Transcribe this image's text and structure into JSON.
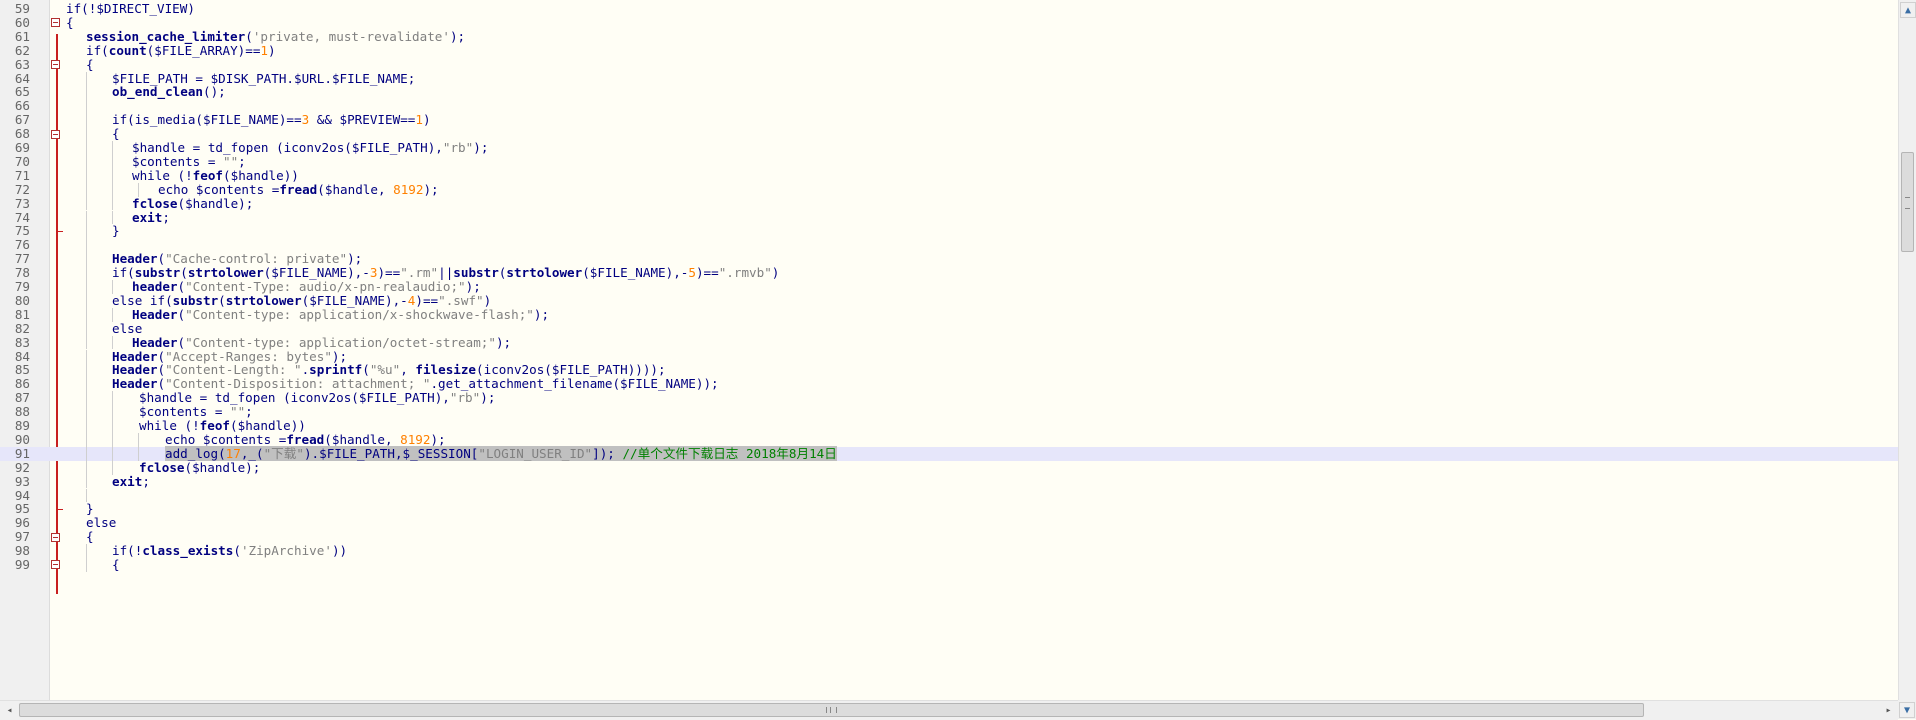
{
  "editor": {
    "lines": [
      {
        "n": "59",
        "indent": 0,
        "fold": "",
        "tokens": [
          [
            "kw",
            "if(!"
          ],
          [
            "var",
            "$DIRECT_VIEW"
          ],
          [
            "kw",
            ")"
          ]
        ]
      },
      {
        "n": "60",
        "indent": 0,
        "fold": "open",
        "tokens": [
          [
            "kw",
            "{"
          ]
        ]
      },
      {
        "n": "61",
        "indent": 1,
        "fold": "",
        "tokens": [
          [
            "fn",
            "session_cache_limiter"
          ],
          [
            "kw",
            "("
          ],
          [
            "str",
            "'private, must-revalidate'"
          ],
          [
            "kw",
            ");"
          ]
        ]
      },
      {
        "n": "62",
        "indent": 1,
        "fold": "",
        "tokens": [
          [
            "kw",
            "if("
          ],
          [
            "fn",
            "count"
          ],
          [
            "kw",
            "("
          ],
          [
            "var",
            "$FILE_ARRAY"
          ],
          [
            "kw",
            ")=="
          ],
          [
            "num",
            "1"
          ],
          [
            "kw",
            ")"
          ]
        ]
      },
      {
        "n": "63",
        "indent": 1,
        "fold": "open",
        "tokens": [
          [
            "kw",
            "{"
          ]
        ]
      },
      {
        "n": "64",
        "indent": 2,
        "fold": "",
        "tokens": [
          [
            "var",
            "$FILE_PATH"
          ],
          [
            "kw",
            " = "
          ],
          [
            "var",
            "$DISK_PATH"
          ],
          [
            "kw",
            "."
          ],
          [
            "var",
            "$URL"
          ],
          [
            "kw",
            "."
          ],
          [
            "var",
            "$FILE_NAME"
          ],
          [
            "kw",
            ";"
          ]
        ]
      },
      {
        "n": "65",
        "indent": 2,
        "fold": "",
        "tokens": [
          [
            "fn",
            "ob_end_clean"
          ],
          [
            "kw",
            "();"
          ]
        ]
      },
      {
        "n": "66",
        "indent": 2,
        "fold": "",
        "tokens": []
      },
      {
        "n": "67",
        "indent": 2,
        "fold": "",
        "tokens": [
          [
            "kw",
            "if(is_media("
          ],
          [
            "var",
            "$FILE_NAME"
          ],
          [
            "kw",
            ")=="
          ],
          [
            "num",
            "3"
          ],
          [
            "kw",
            " && "
          ],
          [
            "var",
            "$PREVIEW"
          ],
          [
            "kw",
            "=="
          ],
          [
            "num",
            "1"
          ],
          [
            "kw",
            ")"
          ]
        ]
      },
      {
        "n": "68",
        "indent": 2,
        "fold": "open",
        "tokens": [
          [
            "kw",
            "{"
          ]
        ]
      },
      {
        "n": "69",
        "indent": 3,
        "fold": "",
        "tokens": [
          [
            "var",
            "$handle"
          ],
          [
            "kw",
            " = td_fopen (iconv2os("
          ],
          [
            "var",
            "$FILE_PATH"
          ],
          [
            "kw",
            "),"
          ],
          [
            "str",
            "\"rb\""
          ],
          [
            "kw",
            ");"
          ]
        ]
      },
      {
        "n": "70",
        "indent": 3,
        "fold": "",
        "tokens": [
          [
            "var",
            "$contents"
          ],
          [
            "kw",
            " = "
          ],
          [
            "str",
            "\"\""
          ],
          [
            "kw",
            ";"
          ]
        ]
      },
      {
        "n": "71",
        "indent": 3,
        "fold": "",
        "tokens": [
          [
            "kw",
            "while (!"
          ],
          [
            "fn",
            "feof"
          ],
          [
            "kw",
            "("
          ],
          [
            "var",
            "$handle"
          ],
          [
            "kw",
            "))"
          ]
        ]
      },
      {
        "n": "72",
        "indent": 4,
        "fold": "",
        "tokens": [
          [
            "kw",
            "echo "
          ],
          [
            "var",
            "$contents"
          ],
          [
            "kw",
            " ="
          ],
          [
            "fn",
            "fread"
          ],
          [
            "kw",
            "("
          ],
          [
            "var",
            "$handle"
          ],
          [
            "kw",
            ", "
          ],
          [
            "num",
            "8192"
          ],
          [
            "kw",
            ");"
          ]
        ]
      },
      {
        "n": "73",
        "indent": 3,
        "fold": "",
        "tokens": [
          [
            "fn",
            "fclose"
          ],
          [
            "kw",
            "("
          ],
          [
            "var",
            "$handle"
          ],
          [
            "kw",
            ");"
          ]
        ]
      },
      {
        "n": "74",
        "indent": 3,
        "fold": "",
        "tokens": [
          [
            "fn",
            "exit"
          ],
          [
            "kw",
            ";"
          ]
        ]
      },
      {
        "n": "75",
        "indent": 2,
        "fold": "end",
        "tokens": [
          [
            "kw",
            "}"
          ]
        ]
      },
      {
        "n": "76",
        "indent": 2,
        "fold": "",
        "tokens": []
      },
      {
        "n": "77",
        "indent": 2,
        "fold": "",
        "tokens": [
          [
            "fn",
            "Header"
          ],
          [
            "kw",
            "("
          ],
          [
            "str",
            "\"Cache-control: private\""
          ],
          [
            "kw",
            ");"
          ]
        ]
      },
      {
        "n": "78",
        "indent": 2,
        "fold": "",
        "tokens": [
          [
            "kw",
            "if("
          ],
          [
            "fn",
            "substr"
          ],
          [
            "kw",
            "("
          ],
          [
            "fn",
            "strtolower"
          ],
          [
            "kw",
            "("
          ],
          [
            "var",
            "$FILE_NAME"
          ],
          [
            "kw",
            "),-"
          ],
          [
            "num",
            "3"
          ],
          [
            "kw",
            ")=="
          ],
          [
            "str",
            "\".rm\""
          ],
          [
            "kw",
            "||"
          ],
          [
            "fn",
            "substr"
          ],
          [
            "kw",
            "("
          ],
          [
            "fn",
            "strtolower"
          ],
          [
            "kw",
            "("
          ],
          [
            "var",
            "$FILE_NAME"
          ],
          [
            "kw",
            "),-"
          ],
          [
            "num",
            "5"
          ],
          [
            "kw",
            ")=="
          ],
          [
            "str",
            "\".rmvb\""
          ],
          [
            "kw",
            ")"
          ]
        ]
      },
      {
        "n": "79",
        "indent": 3,
        "fold": "",
        "tokens": [
          [
            "fn",
            "header"
          ],
          [
            "kw",
            "("
          ],
          [
            "str",
            "\"Content-Type: audio/x-pn-realaudio;\""
          ],
          [
            "kw",
            ");"
          ]
        ]
      },
      {
        "n": "80",
        "indent": 2,
        "fold": "",
        "tokens": [
          [
            "kw",
            "else if("
          ],
          [
            "fn",
            "substr"
          ],
          [
            "kw",
            "("
          ],
          [
            "fn",
            "strtolower"
          ],
          [
            "kw",
            "("
          ],
          [
            "var",
            "$FILE_NAME"
          ],
          [
            "kw",
            "),-"
          ],
          [
            "num",
            "4"
          ],
          [
            "kw",
            ")=="
          ],
          [
            "str",
            "\".swf\""
          ],
          [
            "kw",
            ")"
          ]
        ]
      },
      {
        "n": "81",
        "indent": 3,
        "fold": "",
        "tokens": [
          [
            "fn",
            "Header"
          ],
          [
            "kw",
            "("
          ],
          [
            "str",
            "\"Content-type: application/x-shockwave-flash;\""
          ],
          [
            "kw",
            ");"
          ]
        ]
      },
      {
        "n": "82",
        "indent": 2,
        "fold": "",
        "tokens": [
          [
            "kw",
            "else"
          ]
        ]
      },
      {
        "n": "83",
        "indent": 3,
        "fold": "",
        "tokens": [
          [
            "fn",
            "Header"
          ],
          [
            "kw",
            "("
          ],
          [
            "str",
            "\"Content-type: application/octet-stream;\""
          ],
          [
            "kw",
            ");"
          ]
        ]
      },
      {
        "n": "84",
        "indent": 2,
        "fold": "",
        "tokens": [
          [
            "fn",
            "Header"
          ],
          [
            "kw",
            "("
          ],
          [
            "str",
            "\"Accept-Ranges: bytes\""
          ],
          [
            "kw",
            ");"
          ]
        ]
      },
      {
        "n": "85",
        "indent": 2,
        "fold": "",
        "tokens": [
          [
            "fn",
            "Header"
          ],
          [
            "kw",
            "("
          ],
          [
            "str",
            "\"Content-Length: \""
          ],
          [
            "kw",
            "."
          ],
          [
            "fn",
            "sprintf"
          ],
          [
            "kw",
            "("
          ],
          [
            "str",
            "\"%u\""
          ],
          [
            "kw",
            ", "
          ],
          [
            "fn",
            "filesize"
          ],
          [
            "kw",
            "(iconv2os("
          ],
          [
            "var",
            "$FILE_PATH"
          ],
          [
            "kw",
            "))));"
          ]
        ]
      },
      {
        "n": "86",
        "indent": 2,
        "fold": "",
        "tokens": [
          [
            "fn",
            "Header"
          ],
          [
            "kw",
            "("
          ],
          [
            "str",
            "\"Content-Disposition: attachment; \""
          ],
          [
            "kw",
            ".get_attachment_filename("
          ],
          [
            "var",
            "$FILE_NAME"
          ],
          [
            "kw",
            "));"
          ]
        ]
      },
      {
        "n": "87",
        "indent": 3,
        "fold": "",
        "pad": 1,
        "tokens": [
          [
            "var",
            "$handle"
          ],
          [
            "kw",
            " = td_fopen (iconv2os("
          ],
          [
            "var",
            "$FILE_PATH"
          ],
          [
            "kw",
            "),"
          ],
          [
            "str",
            "\"rb\""
          ],
          [
            "kw",
            ");"
          ]
        ]
      },
      {
        "n": "88",
        "indent": 3,
        "fold": "",
        "pad": 1,
        "tokens": [
          [
            "var",
            "$contents"
          ],
          [
            "kw",
            " = "
          ],
          [
            "str",
            "\"\""
          ],
          [
            "kw",
            ";"
          ]
        ]
      },
      {
        "n": "89",
        "indent": 3,
        "fold": "",
        "pad": 1,
        "tokens": [
          [
            "kw",
            "while (!"
          ],
          [
            "fn",
            "feof"
          ],
          [
            "kw",
            "("
          ],
          [
            "var",
            "$handle"
          ],
          [
            "kw",
            "))"
          ]
        ]
      },
      {
        "n": "90",
        "indent": 4,
        "fold": "",
        "pad": 1,
        "tokens": [
          [
            "kw",
            "echo "
          ],
          [
            "var",
            "$contents"
          ],
          [
            "kw",
            " ="
          ],
          [
            "fn",
            "fread"
          ],
          [
            "kw",
            "("
          ],
          [
            "var",
            "$handle"
          ],
          [
            "kw",
            ", "
          ],
          [
            "num",
            "8192"
          ],
          [
            "kw",
            ");"
          ]
        ]
      },
      {
        "n": "91",
        "indent": 4,
        "fold": "",
        "pad": 1,
        "current": true,
        "tokens": [
          [
            "sel-kw",
            "add_log("
          ],
          [
            "sel-num",
            "17"
          ],
          [
            "sel-kw",
            ",_("
          ],
          [
            "sel-str",
            "\"下载\""
          ],
          [
            "sel-kw",
            ")."
          ],
          [
            "sel-var",
            "$FILE_PATH"
          ],
          [
            "sel-kw",
            ","
          ],
          [
            "sel-var",
            "$_SESSION"
          ],
          [
            "sel-kw",
            "["
          ],
          [
            "sel-str",
            "\"LOGIN_USER_ID\""
          ],
          [
            "sel-kw",
            "]); "
          ],
          [
            "sel-cmt",
            "//单个文件下载日志 2018年8月14日"
          ]
        ]
      },
      {
        "n": "92",
        "indent": 3,
        "fold": "",
        "pad": 1,
        "tokens": [
          [
            "fn",
            "fclose"
          ],
          [
            "kw",
            "("
          ],
          [
            "var",
            "$handle"
          ],
          [
            "kw",
            ");"
          ]
        ]
      },
      {
        "n": "93",
        "indent": 2,
        "fold": "",
        "tokens": [
          [
            "fn",
            "exit"
          ],
          [
            "kw",
            ";"
          ]
        ]
      },
      {
        "n": "94",
        "indent": 2,
        "fold": "",
        "tokens": []
      },
      {
        "n": "95",
        "indent": 1,
        "fold": "end",
        "tokens": [
          [
            "kw",
            "}"
          ]
        ]
      },
      {
        "n": "96",
        "indent": 1,
        "fold": "",
        "tokens": [
          [
            "kw",
            "else"
          ]
        ]
      },
      {
        "n": "97",
        "indent": 1,
        "fold": "open",
        "tokens": [
          [
            "kw",
            "{"
          ]
        ]
      },
      {
        "n": "98",
        "indent": 2,
        "fold": "",
        "tokens": [
          [
            "kw",
            "if(!"
          ],
          [
            "fn",
            "class_exists"
          ],
          [
            "kw",
            "("
          ],
          [
            "str",
            "'ZipArchive'"
          ],
          [
            "kw",
            "))"
          ]
        ]
      },
      {
        "n": "99",
        "indent": 2,
        "fold": "open",
        "tokens": [
          [
            "kw",
            "{"
          ]
        ]
      }
    ]
  },
  "colors": {
    "background": "#fffef5",
    "keyword": "#000080",
    "string": "#808080",
    "number": "#ff8000",
    "comment": "#008000",
    "fold_marker": "#c81f1f",
    "current_line": "#e6e6fa",
    "selection": "#c0c0c0"
  },
  "scrollbars": {
    "vertical": {
      "up_icon": "triangle-up",
      "down_icon": "triangle-down"
    },
    "horizontal": {
      "left_icon": "triangle-left",
      "right_icon": "triangle-right",
      "grip_icon": "grip-lines"
    }
  }
}
